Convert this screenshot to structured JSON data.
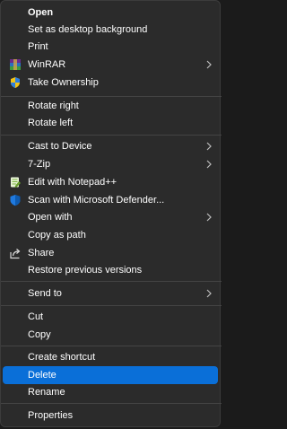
{
  "context_menu": {
    "items": {
      "open": "Open",
      "set_desktop_background": "Set as desktop background",
      "print": "Print",
      "winrar": "WinRAR",
      "take_ownership": "Take Ownership",
      "rotate_right": "Rotate right",
      "rotate_left": "Rotate left",
      "cast_to_device": "Cast to Device",
      "seven_zip": "7-Zip",
      "edit_notepadpp": "Edit with Notepad++",
      "scan_defender": "Scan with Microsoft Defender...",
      "open_with": "Open with",
      "copy_as_path": "Copy as path",
      "share": "Share",
      "restore_previous_versions": "Restore previous versions",
      "send_to": "Send to",
      "cut": "Cut",
      "copy": "Copy",
      "create_shortcut": "Create shortcut",
      "delete": "Delete",
      "rename": "Rename",
      "properties": "Properties"
    }
  },
  "icons": {
    "winrar": "winrar-icon",
    "take_ownership": "uac-shield-icon",
    "notepadpp": "notepadpp-icon",
    "defender": "defender-shield-icon",
    "share": "share-icon",
    "submenu": "chevron-right-icon"
  },
  "colors": {
    "menu_background": "#2b2b2b",
    "highlight": "#0a6fd8",
    "text": "#ffffff",
    "separator": "#444444"
  }
}
